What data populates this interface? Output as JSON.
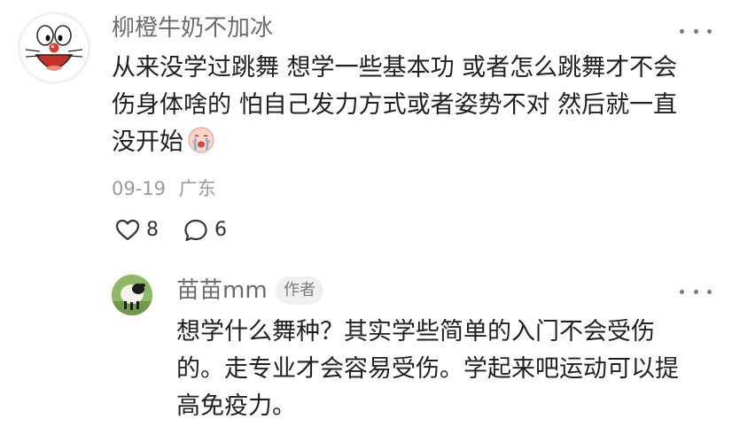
{
  "main_comment": {
    "username": "柳橙牛奶不加冰",
    "text": "从来没学过跳舞 想学一些基本功 或者怎么跳舞才不会伤身体啥的 怕自己发力方式或者姿势不对 然后就一直没开始",
    "emoji": "crying-face-emoji",
    "date": "09-19",
    "location": "广东",
    "likes": "8",
    "comments": "6",
    "avatar": "doraemon-avatar"
  },
  "reply": {
    "username": "苗苗mm",
    "author_tag": "作者",
    "text": "想学什么舞种？其实学些简单的入门不会受伤的。走专业才会容易受伤。学起来吧运动可以提高免疫力。",
    "avatar": "sheep-avatar"
  },
  "icons": {
    "like": "heart-icon",
    "comment": "comment-bubble-icon",
    "more": "more-dots-icon"
  },
  "colors": {
    "username": "#6b6b6b",
    "meta": "#9a9a9a",
    "text": "#202020",
    "tag_bg": "#f0f0f0"
  }
}
